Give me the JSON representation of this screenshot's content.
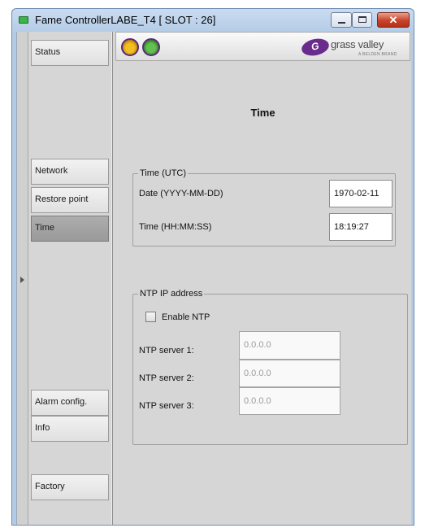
{
  "window": {
    "title": "Fame ControllerLABE_T4 [ SLOT : 26]",
    "buttons": {
      "minimize_icon": "minimize-icon",
      "maximize_icon": "maximize-icon",
      "close_glyph": "✕"
    }
  },
  "sidebar": {
    "items": [
      {
        "label": "Status",
        "active": false
      },
      {
        "label": "Network",
        "active": false
      },
      {
        "label": "Restore point",
        "active": false
      },
      {
        "label": "Time",
        "active": true
      },
      {
        "label": "Alarm config.",
        "active": false
      },
      {
        "label": "Info",
        "active": false
      },
      {
        "label": "Factory",
        "active": false
      }
    ]
  },
  "header": {
    "logo_mark": "G",
    "logo_text": "grass valley",
    "logo_sub": "A BELDEN BRAND"
  },
  "page": {
    "title": "Time"
  },
  "time_group": {
    "legend": "Time (UTC)",
    "date_label": "Date  (YYYY-MM-DD)",
    "date_value": "1970-02-11",
    "time_label": "Time  (HH:MM:SS)",
    "time_value": "18:19:27"
  },
  "ntp_group": {
    "legend": "NTP IP address",
    "enable_label": "Enable NTP",
    "enable_checked": false,
    "servers": [
      {
        "label": "NTP server 1:",
        "value": "0.0.0.0"
      },
      {
        "label": "NTP server 2:",
        "value": "0.0.0.0"
      },
      {
        "label": "NTP server 3:",
        "value": "0.0.0.0"
      }
    ]
  },
  "colors": {
    "active_nav": "#a4a4a4",
    "brand": "#6a2c8c",
    "close_button": "#c8422a"
  }
}
